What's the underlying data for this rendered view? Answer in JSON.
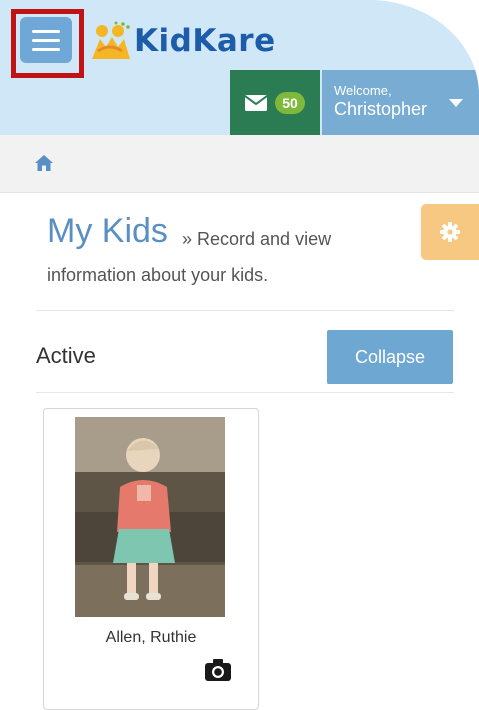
{
  "app": {
    "logo_text": "KidKare"
  },
  "header": {
    "messages_count": "50",
    "welcome_label": "Welcome,",
    "user_name": "Christopher"
  },
  "page": {
    "title": "My Kids",
    "subtitle_part1": "» Record and view",
    "subtitle_part2": "information about your kids."
  },
  "section": {
    "label": "Active",
    "collapse_label": "Collapse"
  },
  "kids": [
    {
      "name": "Allen, Ruthie"
    }
  ],
  "icons": {
    "menu": "hamburger-icon",
    "messages": "envelope-icon",
    "dropdown": "caret-down-icon",
    "home": "home-icon",
    "settings": "gear-icon",
    "photo": "camera-icon"
  },
  "colors": {
    "header_bg": "#cfe7f7",
    "menu_button": "#6fa8d6",
    "messages_button": "#2b7b53",
    "badge": "#7fb93b",
    "welcome_button": "#78acd3",
    "settings_button": "#f7c882",
    "collapse_button": "#6fa7d3",
    "title": "#5a8fc4",
    "highlight": "#c01414"
  }
}
